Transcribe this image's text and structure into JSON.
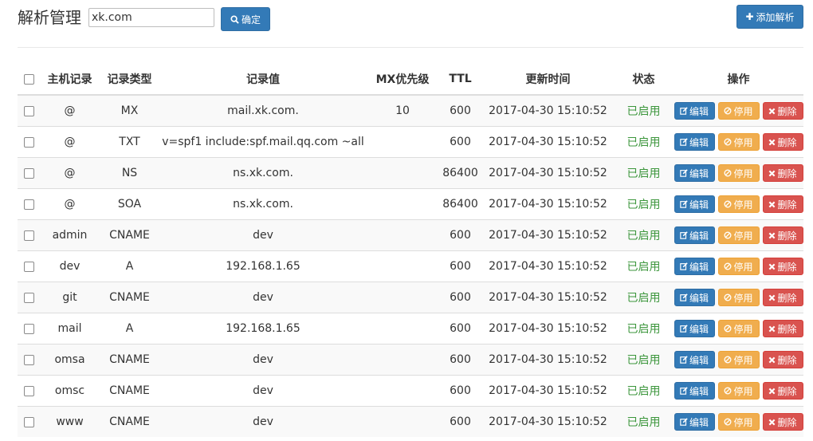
{
  "header": {
    "title": "解析管理",
    "search_value": "xk.com",
    "confirm_label": "确定",
    "add_label": "添加解析"
  },
  "table": {
    "columns": [
      "",
      "主机记录",
      "记录类型",
      "记录值",
      "MX优先级",
      "TTL",
      "更新时间",
      "状态",
      "操作"
    ],
    "rows": [
      {
        "host": "@",
        "type": "MX",
        "value": "mail.xk.com.",
        "mx": "10",
        "ttl": "600",
        "updated": "2017-04-30 15:10:52",
        "status": "已启用"
      },
      {
        "host": "@",
        "type": "TXT",
        "value": "v=spf1 include:spf.mail.qq.com ~all",
        "mx": "",
        "ttl": "600",
        "updated": "2017-04-30 15:10:52",
        "status": "已启用"
      },
      {
        "host": "@",
        "type": "NS",
        "value": "ns.xk.com.",
        "mx": "",
        "ttl": "86400",
        "updated": "2017-04-30 15:10:52",
        "status": "已启用"
      },
      {
        "host": "@",
        "type": "SOA",
        "value": "ns.xk.com.",
        "mx": "",
        "ttl": "86400",
        "updated": "2017-04-30 15:10:52",
        "status": "已启用"
      },
      {
        "host": "admin",
        "type": "CNAME",
        "value": "dev",
        "mx": "",
        "ttl": "600",
        "updated": "2017-04-30 15:10:52",
        "status": "已启用"
      },
      {
        "host": "dev",
        "type": "A",
        "value": "192.168.1.65",
        "mx": "",
        "ttl": "600",
        "updated": "2017-04-30 15:10:52",
        "status": "已启用"
      },
      {
        "host": "git",
        "type": "CNAME",
        "value": "dev",
        "mx": "",
        "ttl": "600",
        "updated": "2017-04-30 15:10:52",
        "status": "已启用"
      },
      {
        "host": "mail",
        "type": "A",
        "value": "192.168.1.65",
        "mx": "",
        "ttl": "600",
        "updated": "2017-04-30 15:10:52",
        "status": "已启用"
      },
      {
        "host": "omsa",
        "type": "CNAME",
        "value": "dev",
        "mx": "",
        "ttl": "600",
        "updated": "2017-04-30 15:10:52",
        "status": "已启用"
      },
      {
        "host": "omsc",
        "type": "CNAME",
        "value": "dev",
        "mx": "",
        "ttl": "600",
        "updated": "2017-04-30 15:10:52",
        "status": "已启用"
      },
      {
        "host": "www",
        "type": "CNAME",
        "value": "dev",
        "mx": "",
        "ttl": "600",
        "updated": "2017-04-30 15:10:52",
        "status": "已启用"
      }
    ]
  },
  "actions": {
    "edit_label": "编辑",
    "disable_label": "停用",
    "delete_label": "删除"
  },
  "icons": {
    "search": "search-icon",
    "add": "plus-icon",
    "edit": "edit-icon",
    "disable": "ban-icon",
    "delete": "close-icon"
  },
  "colors": {
    "primary": "#337ab7",
    "warning": "#f0ad4e",
    "danger": "#d9534f",
    "status_enabled": "#3c963c"
  }
}
